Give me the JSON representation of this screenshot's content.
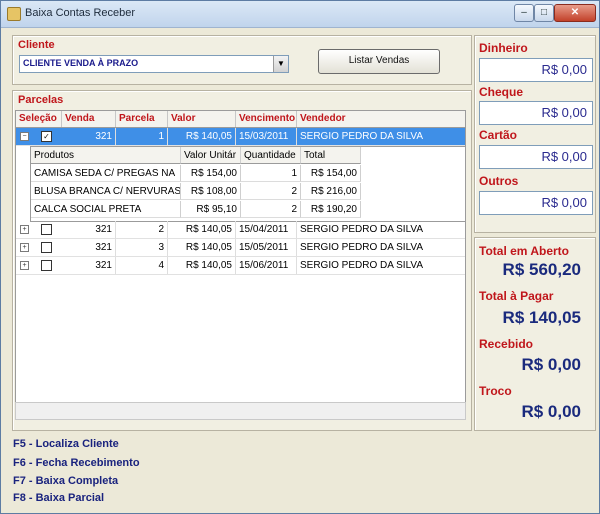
{
  "window": {
    "title": "Baixa Contas Receber"
  },
  "cliente": {
    "label": "Cliente",
    "selected": "CLIENTE VENDA À PRAZO",
    "button": "Listar Vendas"
  },
  "parcelas": {
    "label": "Parcelas",
    "headers": [
      "Seleção",
      "Venda",
      "Parcela",
      "Valor",
      "Vencimento",
      "Vendedor"
    ],
    "rows": [
      {
        "expander": "−",
        "checked": "✓",
        "venda": "321",
        "parcela": "1",
        "valor": "R$ 140,05",
        "vencimento": "15/03/2011",
        "vendedor": "SERGIO PEDRO DA SILVA"
      },
      {
        "expander": "+",
        "checked": "",
        "venda": "321",
        "parcela": "2",
        "valor": "R$ 140,05",
        "vencimento": "15/04/2011",
        "vendedor": "SERGIO PEDRO DA SILVA"
      },
      {
        "expander": "+",
        "checked": "",
        "venda": "321",
        "parcela": "3",
        "valor": "R$ 140,05",
        "vencimento": "15/05/2011",
        "vendedor": "SERGIO PEDRO DA SILVA"
      },
      {
        "expander": "+",
        "checked": "",
        "venda": "321",
        "parcela": "4",
        "valor": "R$ 140,05",
        "vencimento": "15/06/2011",
        "vendedor": "SERGIO PEDRO DA SILVA"
      }
    ],
    "produtos_headers": [
      "Produtos",
      "Valor Unitár",
      "Quantidade",
      "Total"
    ],
    "produtos": [
      {
        "nome": "CAMISA SEDA C/ PREGAS NA",
        "valor": "R$ 154,00",
        "qtd": "1",
        "total": "R$ 154,00"
      },
      {
        "nome": "BLUSA BRANCA C/ NERVURAS",
        "valor": "R$ 108,00",
        "qtd": "2",
        "total": "R$ 216,00"
      },
      {
        "nome": "CALCA SOCIAL PRETA",
        "valor": "R$ 95,10",
        "qtd": "2",
        "total": "R$ 190,20"
      }
    ]
  },
  "pagamento": {
    "dinheiro_label": "Dinheiro",
    "dinheiro": "R$ 0,00",
    "cheque_label": "Cheque",
    "cheque": "R$ 0,00",
    "cartao_label": "Cartão",
    "cartao": "R$ 0,00",
    "outros_label": "Outros",
    "outros": "R$ 0,00"
  },
  "totais": {
    "aberto_label": "Total em Aberto",
    "aberto": "R$ 560,20",
    "pagar_label": "Total à Pagar",
    "pagar": "R$ 140,05",
    "recebido_label": "Recebido",
    "recebido": "R$ 0,00",
    "troco_label": "Troco",
    "troco": "R$ 0,00"
  },
  "shortcuts": [
    "F5 - Localiza Cliente",
    "F6 - Fecha Recebimento",
    "F7 - Baixa Completa",
    "F8 - Baixa Parcial"
  ],
  "colors": {
    "label_red": "#c0161b",
    "selected_row": "#3f8fe7",
    "value_blue": "#1a2a7d"
  }
}
